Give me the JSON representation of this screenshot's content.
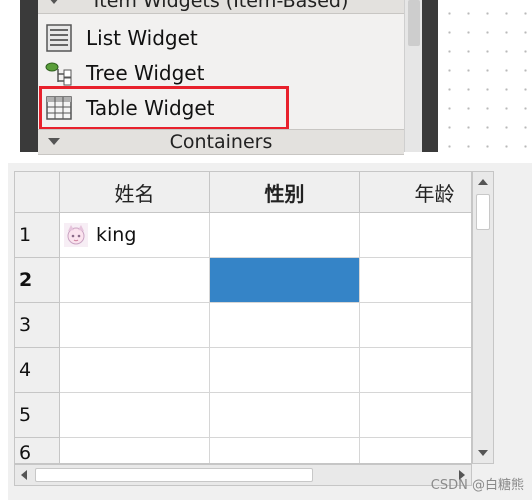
{
  "widget_box": {
    "categories": [
      {
        "label": "Item Widgets (Item-Based)",
        "icon": "collapse-arrow-icon"
      },
      {
        "label": "Containers",
        "icon": "collapse-arrow-icon"
      }
    ],
    "items": [
      {
        "label": "List Widget",
        "icon": "list-widget-icon"
      },
      {
        "label": "Tree Widget",
        "icon": "tree-widget-icon"
      },
      {
        "label": "Table Widget",
        "icon": "table-widget-icon",
        "highlighted": true
      }
    ],
    "highlight_color": "#e8212c"
  },
  "table": {
    "columns": [
      "姓名",
      "性别",
      "年龄"
    ],
    "bold_column_index": 1,
    "row_headers": [
      "1",
      "2",
      "3",
      "4",
      "5",
      "6"
    ],
    "bold_row_index": 1,
    "rows": [
      [
        "king",
        "",
        ""
      ],
      [
        "",
        "",
        ""
      ],
      [
        "",
        "",
        ""
      ],
      [
        "",
        "",
        ""
      ],
      [
        "",
        "",
        ""
      ],
      [
        "",
        "",
        ""
      ]
    ],
    "first_cell_icon": "avatar-icon",
    "selected_cell": {
      "row": 1,
      "col": 1
    },
    "selection_color": "#3584c7"
  },
  "watermark": "CSDN @白糖熊"
}
